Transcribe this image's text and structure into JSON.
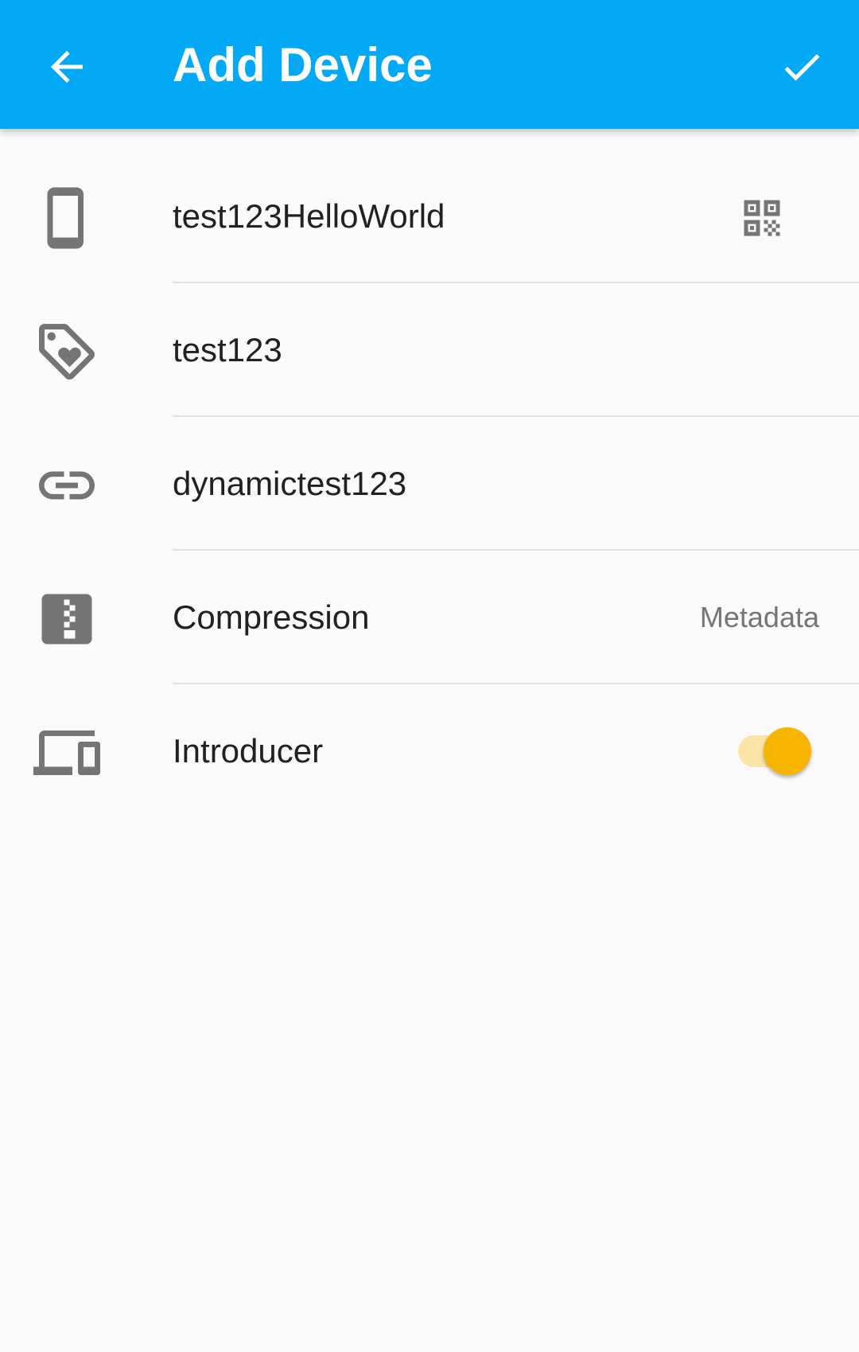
{
  "appbar": {
    "title": "Add Device",
    "back_icon": "arrow-back-icon",
    "done_icon": "check-icon",
    "color": "#03a9f4"
  },
  "fields": {
    "device_id": {
      "value": "test123HelloWorld",
      "icon": "phone-icon",
      "action_icon": "qr-code-icon"
    },
    "device_name": {
      "value": "test123",
      "icon": "tag-icon"
    },
    "address": {
      "value": "dynamictest123",
      "icon": "link-icon"
    },
    "compression": {
      "label": "Compression",
      "value": "Metadata",
      "icon": "zip-icon"
    },
    "introducer": {
      "label": "Introducer",
      "checked": true,
      "icon": "devices-icon",
      "accent": "#f7b500"
    }
  }
}
